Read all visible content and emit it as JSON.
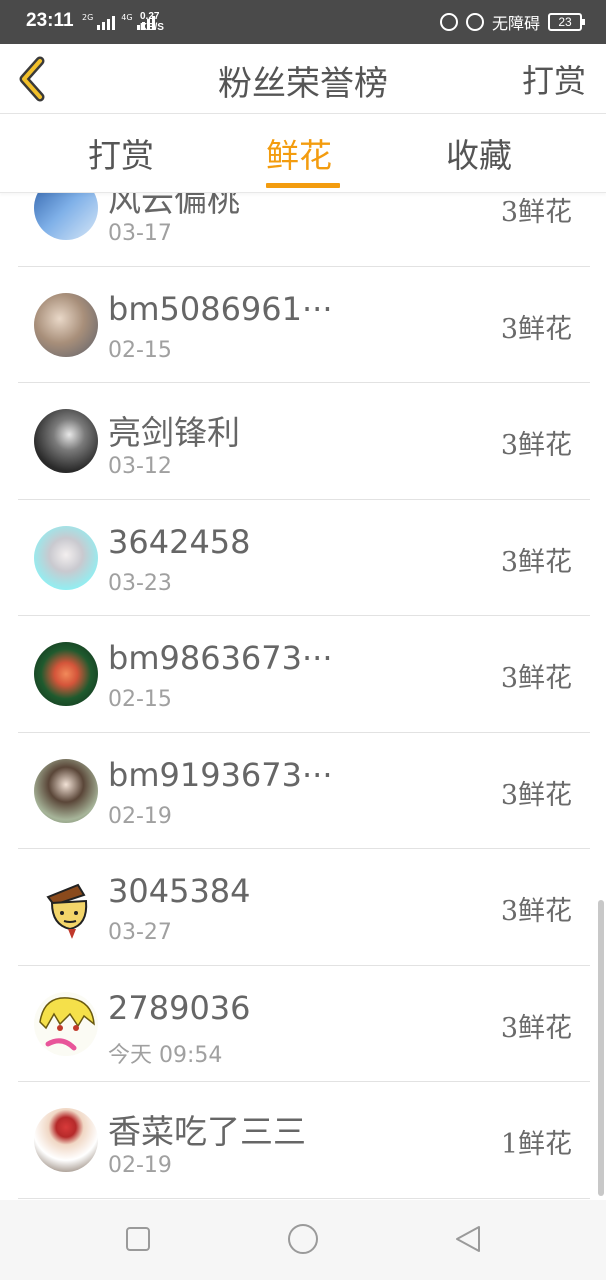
{
  "status_bar": {
    "time": "23:11",
    "net1": "2G",
    "net2": "4G",
    "speed_value": "0.27",
    "speed_unit": "KB/S",
    "accessibility": "无障碍",
    "battery": "23"
  },
  "header": {
    "title": "粉丝荣誉榜",
    "action": "打赏",
    "accent": "#f39c0f"
  },
  "tabs": [
    {
      "label": "打赏",
      "active": false
    },
    {
      "label": "鲜花",
      "active": true
    },
    {
      "label": "收藏",
      "active": false
    }
  ],
  "list": [
    {
      "name": "风云偏桃",
      "date": "03-17",
      "gift": "3鲜花"
    },
    {
      "name": "bm5086961···",
      "date": "02-15",
      "gift": "3鲜花"
    },
    {
      "name": "亮剑锋利",
      "date": "03-12",
      "gift": "3鲜花"
    },
    {
      "name": "3642458",
      "date": "03-23",
      "gift": "3鲜花"
    },
    {
      "name": "bm9863673···",
      "date": "02-15",
      "gift": "3鲜花"
    },
    {
      "name": "bm9193673···",
      "date": "02-19",
      "gift": "3鲜花"
    },
    {
      "name": "3045384",
      "date": "03-27",
      "gift": "3鲜花"
    },
    {
      "name": "2789036",
      "date": "今天 09:54",
      "gift": "3鲜花"
    },
    {
      "name": "香菜吃了三三",
      "date": "02-19",
      "gift": "1鲜花"
    }
  ]
}
